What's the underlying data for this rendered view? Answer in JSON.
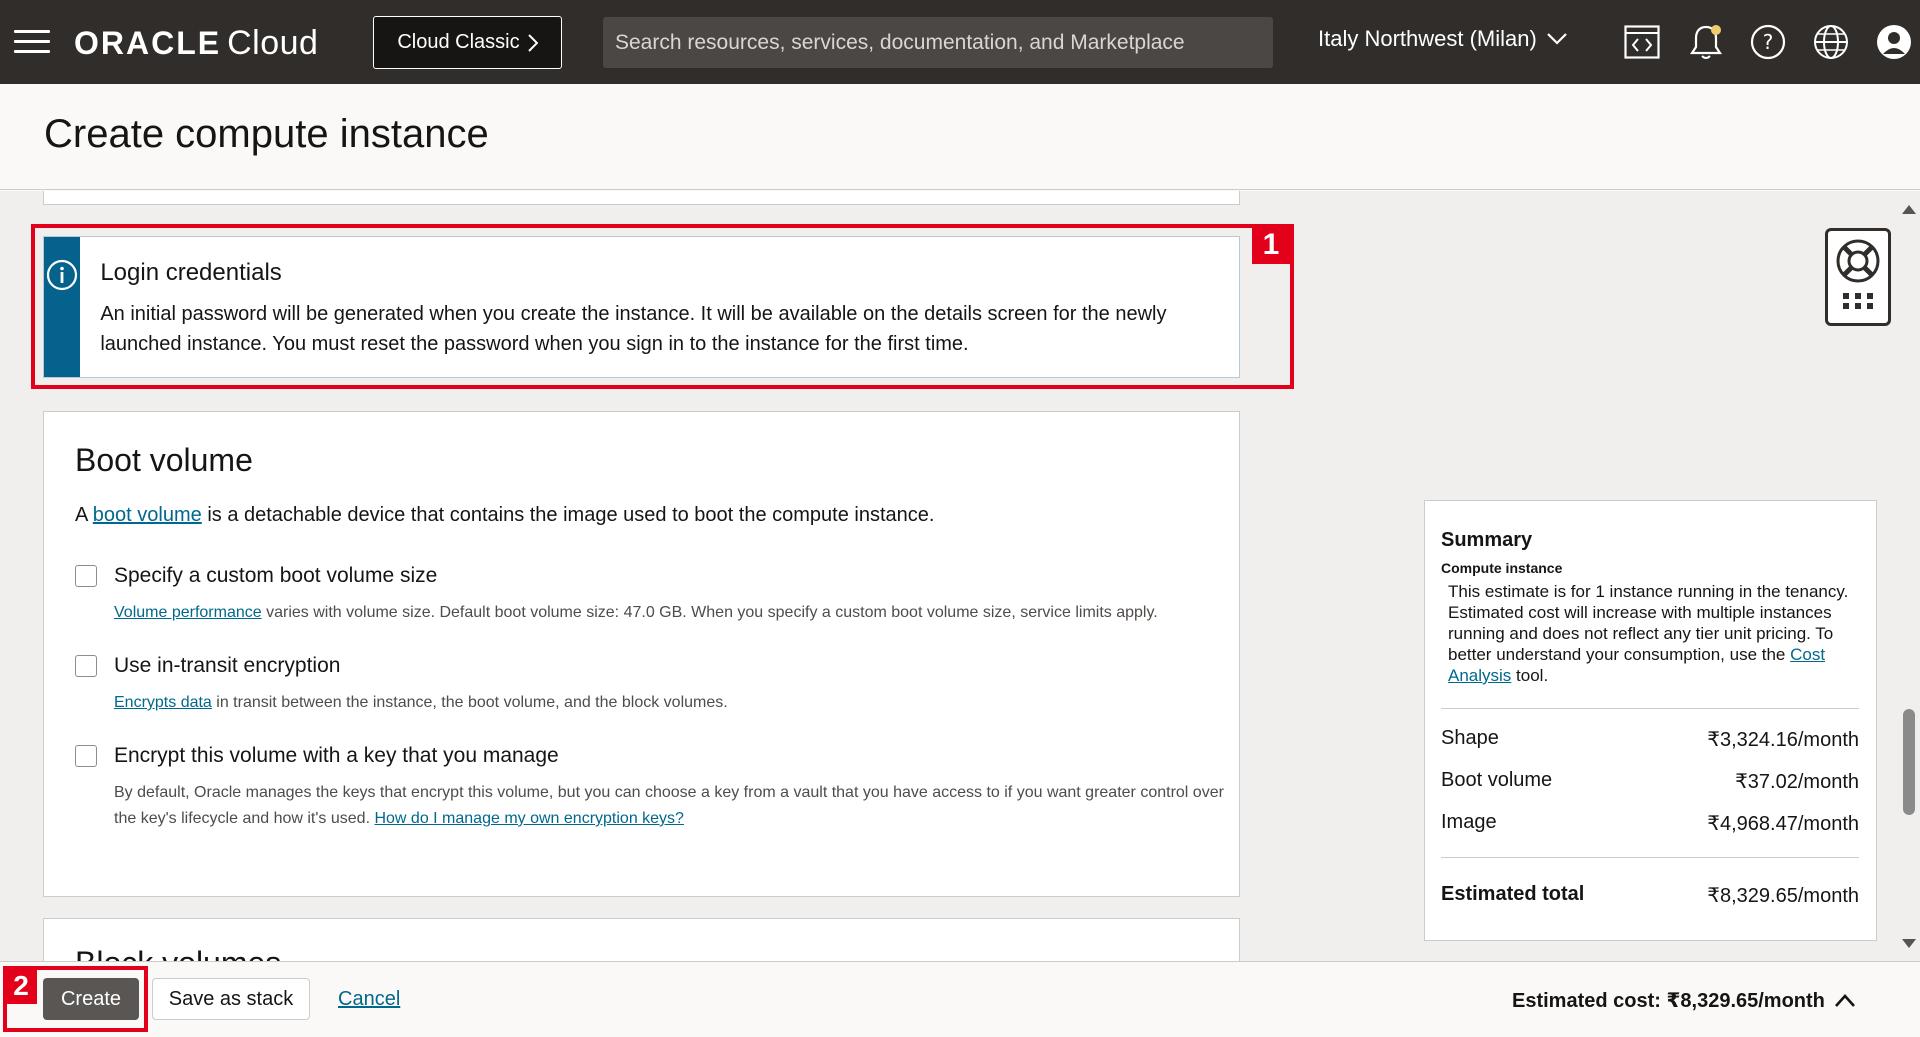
{
  "topbar": {
    "logo_oracle": "ORACLE",
    "logo_cloud": "Cloud",
    "classic_label": "Cloud Classic",
    "search_placeholder": "Search resources, services, documentation, and Marketplace",
    "region": "Italy Northwest (Milan)"
  },
  "page": {
    "title": "Create compute instance"
  },
  "login": {
    "title": "Login credentials",
    "text": "An initial password will be generated when you create the instance. It will be available on the details screen for the newly launched instance. You must reset the password when you sign in to the instance for the first time."
  },
  "annotations": {
    "badge1": "1",
    "badge2": "2"
  },
  "boot": {
    "title": "Boot volume",
    "desc_prefix": "A ",
    "desc_link": "boot volume",
    "desc_suffix": " is a detachable device that contains the image used to boot the compute instance.",
    "options": [
      {
        "label": "Specify a custom boot volume size",
        "help_link": "Volume performance",
        "help_text": " varies with volume size. Default boot volume size: 47.0 GB. When you specify a custom boot volume size, service limits apply.",
        "help_link2": "",
        "checked": false
      },
      {
        "label": "Use in-transit encryption",
        "help_link": "Encrypts data",
        "help_text": " in transit between the instance, the boot volume, and the block volumes.",
        "help_link2": "",
        "checked": false
      },
      {
        "label": "Encrypt this volume with a key that you manage",
        "help_link": "",
        "help_text": "By default, Oracle manages the keys that encrypt this volume, but you can choose a key from a vault that you have access to if you want greater control over the key's lifecycle and how it's used. ",
        "help_link2": "How do I manage my own encryption keys?",
        "checked": false
      }
    ]
  },
  "next_section": {
    "title": "Block volumes"
  },
  "summary": {
    "title": "Summary",
    "subtitle": "Compute instance",
    "note_text": "This estimate is for 1 instance running in the tenancy. Estimated cost will increase with multiple instances running and does not reflect any tier unit pricing. To better understand your consumption, use the ",
    "note_link": "Cost Analysis",
    "note_suffix": " tool.",
    "rows": [
      {
        "label": "Shape",
        "value": "₹3,324.16/month"
      },
      {
        "label": "Boot volume",
        "value": "₹37.02/month"
      },
      {
        "label": "Image",
        "value": "₹4,968.47/month"
      }
    ],
    "total_label": "Estimated total",
    "total_value": "₹8,329.65/month"
  },
  "footer": {
    "create_label": "Create",
    "stack_label": "Save as stack",
    "cancel_label": "Cancel",
    "est_cost": "Estimated cost: ₹8,329.65/month"
  },
  "colors": {
    "accent": "#04628d",
    "annotation": "#e3001b",
    "topbar": "#312d2a"
  }
}
